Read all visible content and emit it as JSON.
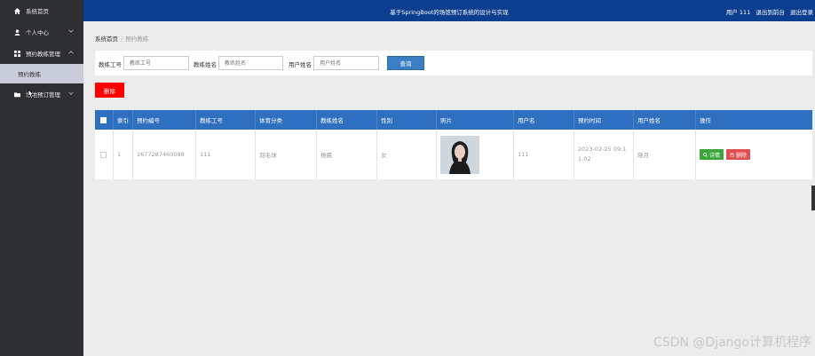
{
  "sidebar": {
    "items": [
      {
        "label": "系统首页"
      },
      {
        "label": "个人中心"
      },
      {
        "label": "预约教练管理"
      },
      {
        "label": "场地预订管理"
      }
    ],
    "sub_item": "预约教练"
  },
  "header": {
    "title": "基于SpringBoot的场馆预订系统的设计与实现",
    "user": "用户 111",
    "back_to_front": "退出到前台",
    "logout": "退出登录"
  },
  "breadcrumb": {
    "home": "系统首页",
    "current": "预约教练"
  },
  "search": {
    "coach_id_label": "教练工号",
    "coach_id_placeholder": "教练工号",
    "coach_name_label": "教练姓名",
    "coach_name_placeholder": "教练姓名",
    "user_name_label": "用户姓名",
    "user_name_placeholder": "用户姓名",
    "query_button": "查询"
  },
  "toolbar": {
    "delete_button": "删除"
  },
  "table": {
    "headers": [
      "索引",
      "预约编号",
      "教练工号",
      "体育分类",
      "教练姓名",
      "性别",
      "照片",
      "用户名",
      "预约时间",
      "用户姓名",
      "操作"
    ],
    "rows": [
      {
        "index": "1",
        "booking_no": "1677287460098",
        "coach_id": "111",
        "category": "羽毛球",
        "coach_name": "杨晨",
        "gender": "女",
        "username": "111",
        "time": "2023-02-25 09:11:02",
        "user_name": "晓月",
        "detail_label": "详情",
        "delete_label": "删除"
      }
    ]
  },
  "watermark": "CSDN @Django计算机程序"
}
